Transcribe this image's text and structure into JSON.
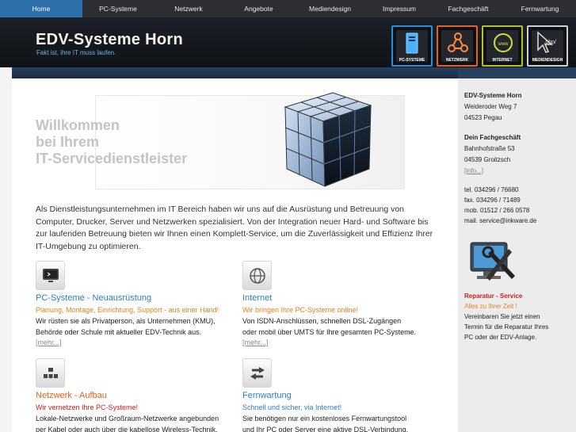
{
  "nav": {
    "items": [
      {
        "label": "Home",
        "active": true
      },
      {
        "label": "PC-Systeme",
        "active": false
      },
      {
        "label": "Netzwerk",
        "active": false
      },
      {
        "label": "Angebote",
        "active": false
      },
      {
        "label": "Mediendesign",
        "active": false
      },
      {
        "label": "Impressum",
        "active": false
      },
      {
        "label": "Fachgeschäft",
        "active": false
      },
      {
        "label": "Fernwartung",
        "active": false
      }
    ]
  },
  "header": {
    "title": "EDV-Systeme Horn",
    "slogan": "Fakt ist, ihre IT muss laufen.",
    "tiles": [
      {
        "label": "PC-SYSTEME",
        "color": "#2a8fd8",
        "icon": "pc-tower-icon"
      },
      {
        "label": "NETZWERK",
        "color": "#e5621e",
        "icon": "network-icon"
      },
      {
        "label": "INTERNET",
        "color": "#b8c21e",
        "icon": "globe-icon"
      },
      {
        "label": "MEDIENDESIGN",
        "color": "#cfcfcf",
        "icon": "php-cursor-icon",
        "text": ".php/"
      }
    ]
  },
  "welcome": {
    "line1": "Willkommen",
    "line2": "bei Ihrem",
    "line3": "IT-Servicedienstleister"
  },
  "intro": "Als Dienstleistungsunternehmen im IT Bereich haben wir uns auf die Ausrüstung und Betreuung von Computer, Drucker, Server und Netzwerken spezialisiert. Von der Integration neuer Hard- und Software bis zur laufenden Betreuung bieten wir Ihnen einen Komplett-Service, um die Zuverlässigkeit und Effizienz Ihrer IT-Umgebung zu optimieren.",
  "sections": {
    "pc": {
      "title": "PC-Systeme - Neuausrüstung",
      "subtitle": "Planung, Montage, Einrichtung, Support - aus einer Hand!",
      "text1": "Wir rüsten sie als Privatperson, als Unternehmen (KMU),",
      "text2": "Behörde oder Schule mit aktueller EDV-Technik aus.",
      "more": "[mehr...]"
    },
    "internet": {
      "title": "Internet",
      "subtitle": "Wir bringen Ihre PC-Systeme online!",
      "text1": "Von ISDN-Anschlüssen, schnellen DSL-Zugängen",
      "text2": "oder mobil über UMTS für Ihre gesamten PC-Systeme.",
      "more": "[mehr...]"
    },
    "netzwerk": {
      "title": "Netzwerk - Aufbau",
      "subtitle": "Wir vernetzen Ihre PC-Systeme!",
      "text1": "Lokale-Netzwerke und Großraum-Netzwerke angebunden",
      "text2": "per Kabel oder auch über die kabellose Wireless-Technik."
    },
    "fernwartung": {
      "title": "Fernwartung",
      "subtitle": "Schnell und sicher, via Internet!",
      "text1": "Sie benötigen nur ein kostenloses Fernwartungstool",
      "text2": "und Ihr PC oder Server eine aktive DSL-Verbindung."
    }
  },
  "sidebar": {
    "company": "EDV-Systeme Horn",
    "street": "Weideroder Weg 7",
    "city": "04523 Pegau",
    "shop_title": "Dein Fachgeschäft",
    "shop_street": "Bahnhofstraße 53",
    "shop_city": "04539 Groitzsch",
    "info": "[info...]",
    "tel": "tel. 034296 / 76680",
    "fax": "fax. 034296 / 71489",
    "mob": "mob. 01512 / 266 0578",
    "mail": "mail. service@inkware.de",
    "repair_title": "Reparatur - Service",
    "repair_sub": "Alles zu Ihrer Zeit !",
    "repair_text1": "Vereinbaren Sie jetzt einen",
    "repair_text2": "Termin für die Reparatur Ihres",
    "repair_text3": "PC oder der EDV-Anlage."
  }
}
